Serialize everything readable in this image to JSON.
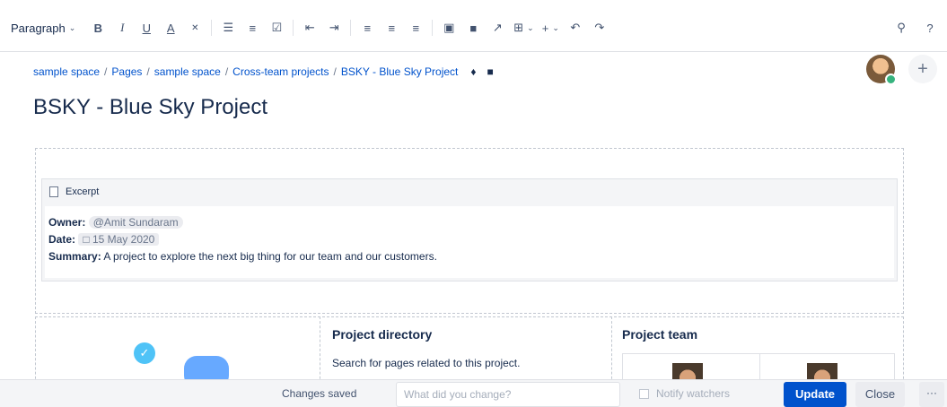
{
  "toolbar": {
    "paragraph_label": "Paragraph",
    "icons": {
      "bold": "B",
      "italic": "I",
      "underline": "U",
      "text_color": "A",
      "clear_format": "✕",
      "bullet_list": "☰",
      "numbered_list": "≡",
      "task_list": "☑",
      "outdent": "⇤",
      "indent": "⇥",
      "align_left": "≡",
      "align_center": "≡",
      "align_right": "≡",
      "layout": "▣",
      "image": "■",
      "link": "↗",
      "table": "⊞",
      "insert": "+",
      "undo": "↶",
      "redo": "↷",
      "search": "⚲",
      "help": "?"
    }
  },
  "breadcrumb": {
    "items": [
      "sample space",
      "Pages",
      "sample space",
      "Cross-team projects",
      "BSKY - Blue Sky Project"
    ],
    "separator": "/"
  },
  "page": {
    "title": "BSKY - Blue Sky Project"
  },
  "excerpt": {
    "header": "Excerpt",
    "owner_label": "Owner:",
    "owner_value": "@Amit Sundaram",
    "date_label": "Date:",
    "date_value": "15 May 2020",
    "summary_label": "Summary:",
    "summary_value": "A project to explore the next big thing for our team and our customers."
  },
  "project_directory": {
    "title": "Project directory",
    "description": "Search for pages related to this project."
  },
  "project_team": {
    "title": "Project team"
  },
  "footer": {
    "status": "Changes saved",
    "change_placeholder": "What did you change?",
    "notify_label": "Notify watchers",
    "update_label": "Update",
    "close_label": "Close",
    "more_label": "···"
  },
  "colors": {
    "primary": "#0052cc",
    "link": "#0052cc",
    "text": "#172b4d"
  }
}
